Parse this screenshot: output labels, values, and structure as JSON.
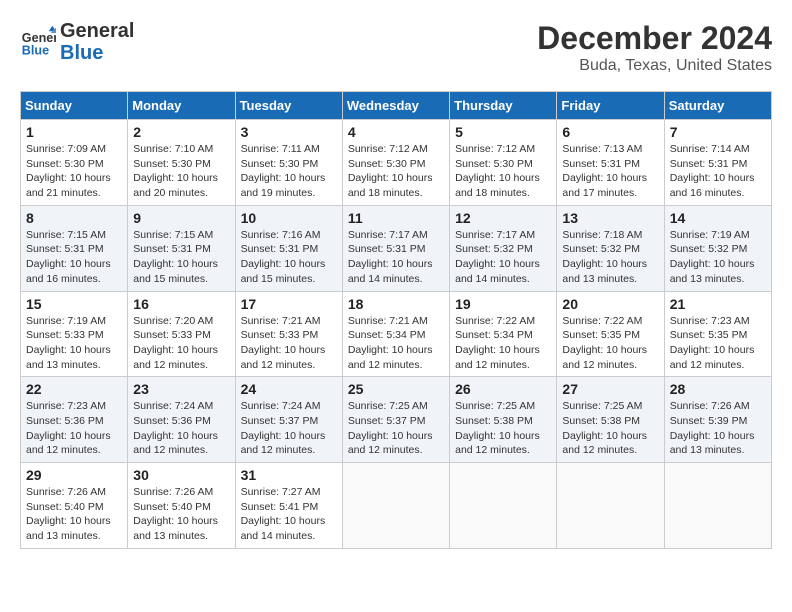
{
  "header": {
    "logo_line1": "General",
    "logo_line2": "Blue",
    "month": "December 2024",
    "location": "Buda, Texas, United States"
  },
  "weekdays": [
    "Sunday",
    "Monday",
    "Tuesday",
    "Wednesday",
    "Thursday",
    "Friday",
    "Saturday"
  ],
  "weeks": [
    [
      {
        "day": "1",
        "info": "Sunrise: 7:09 AM\nSunset: 5:30 PM\nDaylight: 10 hours\nand 21 minutes."
      },
      {
        "day": "2",
        "info": "Sunrise: 7:10 AM\nSunset: 5:30 PM\nDaylight: 10 hours\nand 20 minutes."
      },
      {
        "day": "3",
        "info": "Sunrise: 7:11 AM\nSunset: 5:30 PM\nDaylight: 10 hours\nand 19 minutes."
      },
      {
        "day": "4",
        "info": "Sunrise: 7:12 AM\nSunset: 5:30 PM\nDaylight: 10 hours\nand 18 minutes."
      },
      {
        "day": "5",
        "info": "Sunrise: 7:12 AM\nSunset: 5:30 PM\nDaylight: 10 hours\nand 18 minutes."
      },
      {
        "day": "6",
        "info": "Sunrise: 7:13 AM\nSunset: 5:31 PM\nDaylight: 10 hours\nand 17 minutes."
      },
      {
        "day": "7",
        "info": "Sunrise: 7:14 AM\nSunset: 5:31 PM\nDaylight: 10 hours\nand 16 minutes."
      }
    ],
    [
      {
        "day": "8",
        "info": "Sunrise: 7:15 AM\nSunset: 5:31 PM\nDaylight: 10 hours\nand 16 minutes."
      },
      {
        "day": "9",
        "info": "Sunrise: 7:15 AM\nSunset: 5:31 PM\nDaylight: 10 hours\nand 15 minutes."
      },
      {
        "day": "10",
        "info": "Sunrise: 7:16 AM\nSunset: 5:31 PM\nDaylight: 10 hours\nand 15 minutes."
      },
      {
        "day": "11",
        "info": "Sunrise: 7:17 AM\nSunset: 5:31 PM\nDaylight: 10 hours\nand 14 minutes."
      },
      {
        "day": "12",
        "info": "Sunrise: 7:17 AM\nSunset: 5:32 PM\nDaylight: 10 hours\nand 14 minutes."
      },
      {
        "day": "13",
        "info": "Sunrise: 7:18 AM\nSunset: 5:32 PM\nDaylight: 10 hours\nand 13 minutes."
      },
      {
        "day": "14",
        "info": "Sunrise: 7:19 AM\nSunset: 5:32 PM\nDaylight: 10 hours\nand 13 minutes."
      }
    ],
    [
      {
        "day": "15",
        "info": "Sunrise: 7:19 AM\nSunset: 5:33 PM\nDaylight: 10 hours\nand 13 minutes."
      },
      {
        "day": "16",
        "info": "Sunrise: 7:20 AM\nSunset: 5:33 PM\nDaylight: 10 hours\nand 12 minutes."
      },
      {
        "day": "17",
        "info": "Sunrise: 7:21 AM\nSunset: 5:33 PM\nDaylight: 10 hours\nand 12 minutes."
      },
      {
        "day": "18",
        "info": "Sunrise: 7:21 AM\nSunset: 5:34 PM\nDaylight: 10 hours\nand 12 minutes."
      },
      {
        "day": "19",
        "info": "Sunrise: 7:22 AM\nSunset: 5:34 PM\nDaylight: 10 hours\nand 12 minutes."
      },
      {
        "day": "20",
        "info": "Sunrise: 7:22 AM\nSunset: 5:35 PM\nDaylight: 10 hours\nand 12 minutes."
      },
      {
        "day": "21",
        "info": "Sunrise: 7:23 AM\nSunset: 5:35 PM\nDaylight: 10 hours\nand 12 minutes."
      }
    ],
    [
      {
        "day": "22",
        "info": "Sunrise: 7:23 AM\nSunset: 5:36 PM\nDaylight: 10 hours\nand 12 minutes."
      },
      {
        "day": "23",
        "info": "Sunrise: 7:24 AM\nSunset: 5:36 PM\nDaylight: 10 hours\nand 12 minutes."
      },
      {
        "day": "24",
        "info": "Sunrise: 7:24 AM\nSunset: 5:37 PM\nDaylight: 10 hours\nand 12 minutes."
      },
      {
        "day": "25",
        "info": "Sunrise: 7:25 AM\nSunset: 5:37 PM\nDaylight: 10 hours\nand 12 minutes."
      },
      {
        "day": "26",
        "info": "Sunrise: 7:25 AM\nSunset: 5:38 PM\nDaylight: 10 hours\nand 12 minutes."
      },
      {
        "day": "27",
        "info": "Sunrise: 7:25 AM\nSunset: 5:38 PM\nDaylight: 10 hours\nand 12 minutes."
      },
      {
        "day": "28",
        "info": "Sunrise: 7:26 AM\nSunset: 5:39 PM\nDaylight: 10 hours\nand 13 minutes."
      }
    ],
    [
      {
        "day": "29",
        "info": "Sunrise: 7:26 AM\nSunset: 5:40 PM\nDaylight: 10 hours\nand 13 minutes."
      },
      {
        "day": "30",
        "info": "Sunrise: 7:26 AM\nSunset: 5:40 PM\nDaylight: 10 hours\nand 13 minutes."
      },
      {
        "day": "31",
        "info": "Sunrise: 7:27 AM\nSunset: 5:41 PM\nDaylight: 10 hours\nand 14 minutes."
      },
      {
        "day": "",
        "info": ""
      },
      {
        "day": "",
        "info": ""
      },
      {
        "day": "",
        "info": ""
      },
      {
        "day": "",
        "info": ""
      }
    ]
  ]
}
